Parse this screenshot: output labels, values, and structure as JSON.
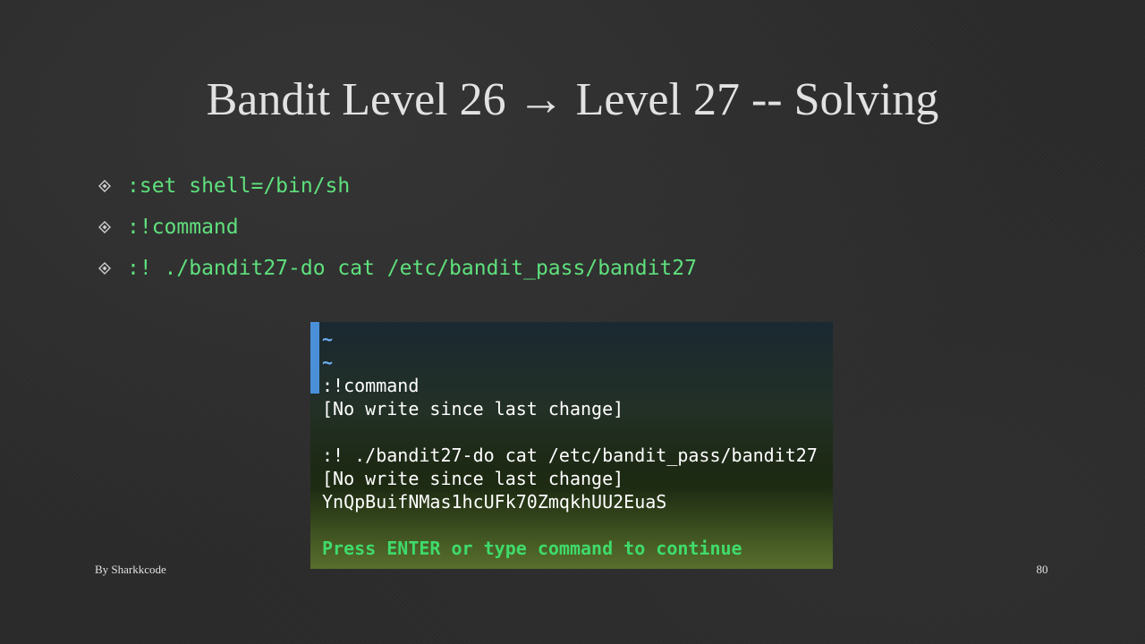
{
  "slide": {
    "title": "Bandit Level 26 → Level 27 -- Solving",
    "bullets": [
      ":set shell=/bin/sh",
      ":!command",
      ":! ./bandit27-do cat /etc/bandit_pass/bandit27"
    ],
    "bullet_icon": "diamond-bullet-icon"
  },
  "terminal": {
    "lines": [
      "~",
      "~",
      ":!command",
      "[No write since last change]",
      "",
      ":! ./bandit27-do cat /etc/bandit_pass/bandit27",
      "[No write since last change]",
      "YnQpBuifNMas1hcUFk70ZmqkhUU2EuaS",
      "",
      "Press ENTER or type command to continue"
    ]
  },
  "footer": {
    "author": "By Sharkkcode",
    "page_number": "80"
  },
  "colors": {
    "background": "#2a2a2a",
    "title": "#e2e2e2",
    "bullet_text": "#5fe07d",
    "terminal_prompt": "#3fdb6a",
    "terminal_tilde": "#6aaef0"
  }
}
